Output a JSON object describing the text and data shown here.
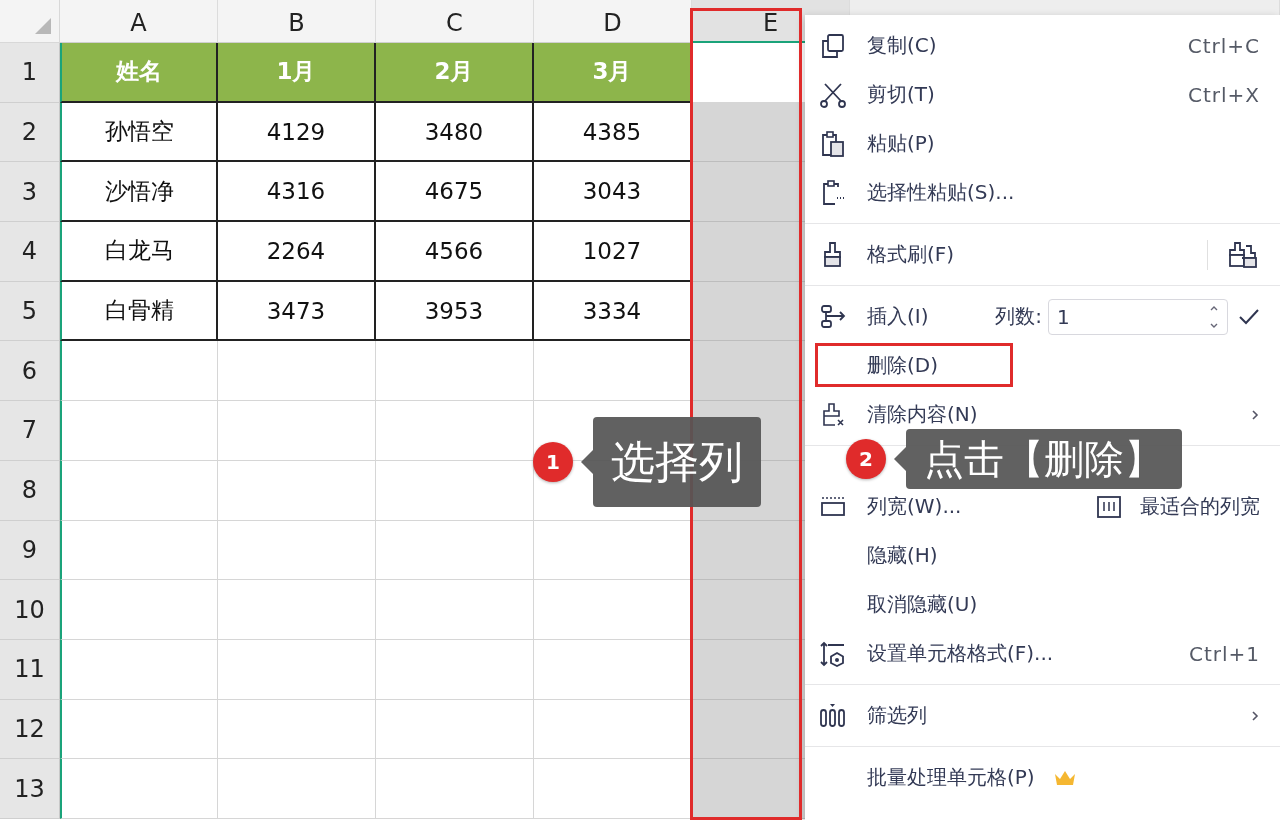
{
  "sheet": {
    "columns": [
      {
        "label": "A",
        "selected": false
      },
      {
        "label": "B",
        "selected": false
      },
      {
        "label": "C",
        "selected": false
      },
      {
        "label": "D",
        "selected": false
      },
      {
        "label": "E",
        "selected": true
      }
    ],
    "rows": [
      {
        "number": "1",
        "kind": "header",
        "cells": [
          "姓名",
          "1月",
          "2月",
          "3月"
        ]
      },
      {
        "number": "2",
        "kind": "data",
        "cells": [
          "孙悟空",
          "4129",
          "3480",
          "4385"
        ]
      },
      {
        "number": "3",
        "kind": "data",
        "cells": [
          "沙悟净",
          "4316",
          "4675",
          "3043"
        ]
      },
      {
        "number": "4",
        "kind": "data",
        "cells": [
          "白龙马",
          "2264",
          "4566",
          "1027"
        ]
      },
      {
        "number": "5",
        "kind": "data",
        "cells": [
          "白骨精",
          "3473",
          "3953",
          "3334"
        ]
      },
      {
        "number": "6",
        "kind": "blank"
      },
      {
        "number": "7",
        "kind": "blank"
      },
      {
        "number": "8",
        "kind": "blank"
      },
      {
        "number": "9",
        "kind": "blank"
      },
      {
        "number": "10",
        "kind": "blank"
      },
      {
        "number": "11",
        "kind": "blank"
      },
      {
        "number": "12",
        "kind": "blank"
      },
      {
        "number": "13",
        "kind": "blank"
      }
    ]
  },
  "context_menu": {
    "items": [
      {
        "kind": "command",
        "label": "复制(C)",
        "shortcut": "Ctrl+C",
        "highlighted": false
      },
      {
        "kind": "command",
        "label": "剪切(T)",
        "shortcut": "Ctrl+X",
        "highlighted": false
      },
      {
        "kind": "command",
        "label": "粘贴(P)",
        "highlighted": false
      },
      {
        "kind": "command",
        "label": "选择性粘贴(S)...",
        "highlighted": false
      },
      {
        "kind": "separator"
      },
      {
        "kind": "brush",
        "label": "格式刷(F)",
        "highlighted": false
      },
      {
        "kind": "separator"
      },
      {
        "kind": "insert",
        "label": "插入(I)",
        "count_label": "列数:",
        "count_value": "1",
        "highlighted": false
      },
      {
        "kind": "command",
        "label": "删除(D)",
        "highlighted": true
      },
      {
        "kind": "submenu",
        "label": "清除内容(N)",
        "highlighted": false
      },
      {
        "kind": "separator"
      },
      {
        "kind": "width",
        "label": "列宽(W)...",
        "extra": "最适合的列宽",
        "highlighted": false
      },
      {
        "kind": "command",
        "label": "隐藏(H)",
        "highlighted": false
      },
      {
        "kind": "command",
        "label": "取消隐藏(U)",
        "highlighted": false
      },
      {
        "kind": "command",
        "label": "设置单元格格式(F)...",
        "shortcut": "Ctrl+1",
        "highlighted": false
      },
      {
        "kind": "separator"
      },
      {
        "kind": "submenu",
        "label": "筛选列",
        "highlighted": false
      },
      {
        "kind": "separator"
      },
      {
        "kind": "premium",
        "label": "批量处理单元格(P)",
        "highlighted": false
      }
    ]
  },
  "annotations": [
    {
      "number": "1",
      "text": "选择列"
    },
    {
      "number": "2",
      "text": "点击【删除】"
    }
  ]
}
